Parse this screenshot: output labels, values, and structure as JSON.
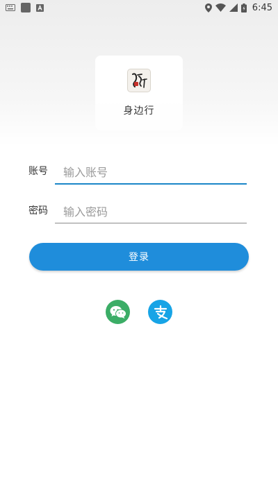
{
  "status_bar": {
    "time": "6:45",
    "icons": [
      "keyboard-icon",
      "app-square-icon",
      "text-app-icon",
      "location-icon",
      "wifi-icon",
      "signal-icon",
      "battery-icon"
    ]
  },
  "logo": {
    "app_name": "身边行",
    "logo_text": "身边行"
  },
  "form": {
    "account": {
      "label": "账号",
      "placeholder": "输入账号",
      "value": ""
    },
    "password": {
      "label": "密码",
      "placeholder": "输入密码",
      "value": ""
    }
  },
  "login_button": {
    "label": "登录"
  },
  "social_login": [
    {
      "name": "wechat",
      "icon": "wechat-icon",
      "color": "#3bad66"
    },
    {
      "name": "alipay",
      "icon": "alipay-icon",
      "color": "#17a4e6"
    }
  ],
  "colors": {
    "primary": "#1f8ddb",
    "input_active": "#1a86c8"
  }
}
